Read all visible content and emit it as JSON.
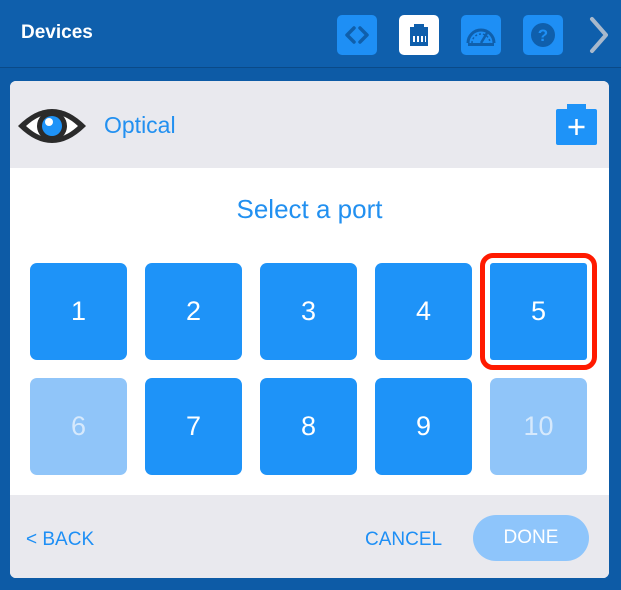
{
  "header": {
    "title": "Devices"
  },
  "device": {
    "name": "Optical",
    "icon": "eye-icon"
  },
  "prompt": "Select a port",
  "ports": [
    {
      "label": "1",
      "state": "enabled"
    },
    {
      "label": "2",
      "state": "enabled"
    },
    {
      "label": "3",
      "state": "enabled"
    },
    {
      "label": "4",
      "state": "enabled"
    },
    {
      "label": "5",
      "state": "selected"
    },
    {
      "label": "6",
      "state": "disabled"
    },
    {
      "label": "7",
      "state": "enabled"
    },
    {
      "label": "8",
      "state": "enabled"
    },
    {
      "label": "9",
      "state": "enabled"
    },
    {
      "label": "10",
      "state": "disabled"
    }
  ],
  "footer": {
    "back_label": "< BACK",
    "cancel_label": "CANCEL",
    "done_label": "DONE"
  },
  "colors": {
    "header_bg": "#0f5fac",
    "accent": "#1e93f8",
    "disabled": "#90c5f9",
    "selection_outline": "#ff1a00"
  }
}
